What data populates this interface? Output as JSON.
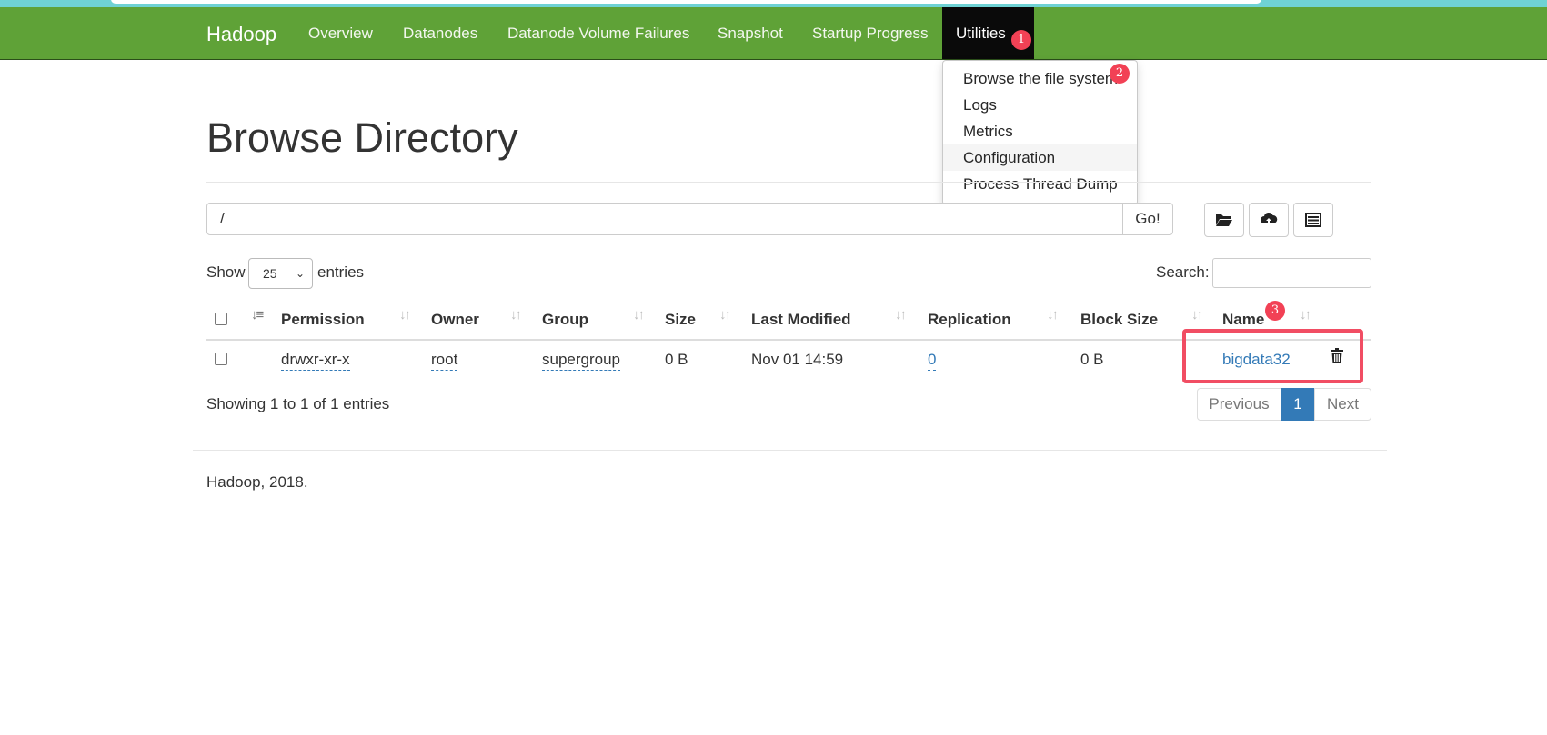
{
  "navbar": {
    "brand": "Hadoop",
    "items": [
      "Overview",
      "Datanodes",
      "Datanode Volume Failures",
      "Snapshot",
      "Startup Progress",
      "Utilities"
    ],
    "active": "Utilities"
  },
  "utilities_menu": {
    "items": [
      "Browse the file system",
      "Logs",
      "Metrics",
      "Configuration",
      "Process Thread Dump"
    ],
    "highlighted": "Configuration"
  },
  "markers": [
    "1",
    "2",
    "3"
  ],
  "page_title": "Browse Directory",
  "path_bar": {
    "value": "/",
    "go_label": "Go!"
  },
  "toolbar_icons": [
    "folder-open-icon",
    "cloud-upload-icon",
    "list-icon"
  ],
  "length_control": {
    "prefix": "Show",
    "value": "25",
    "suffix": "entries"
  },
  "search": {
    "label": "Search:",
    "value": ""
  },
  "table": {
    "columns": [
      "Permission",
      "Owner",
      "Group",
      "Size",
      "Last Modified",
      "Replication",
      "Block Size",
      "Name"
    ],
    "rows": [
      {
        "permission": "drwxr-xr-x",
        "owner": "root",
        "group": "supergroup",
        "size": "0 B",
        "last_modified": "Nov 01 14:59",
        "replication": "0",
        "block_size": "0 B",
        "name": "bigdata32"
      }
    ]
  },
  "info": "Showing 1 to 1 of 1 entries",
  "pagination": {
    "previous": "Previous",
    "current": "1",
    "next": "Next"
  },
  "footer": "Hadoop, 2018.",
  "colors": {
    "navbar": "#5fa237",
    "active_nav": "#0a0a0a",
    "link": "#337ab7",
    "marker": "#f24155",
    "highlight_box": "#f14d63"
  }
}
